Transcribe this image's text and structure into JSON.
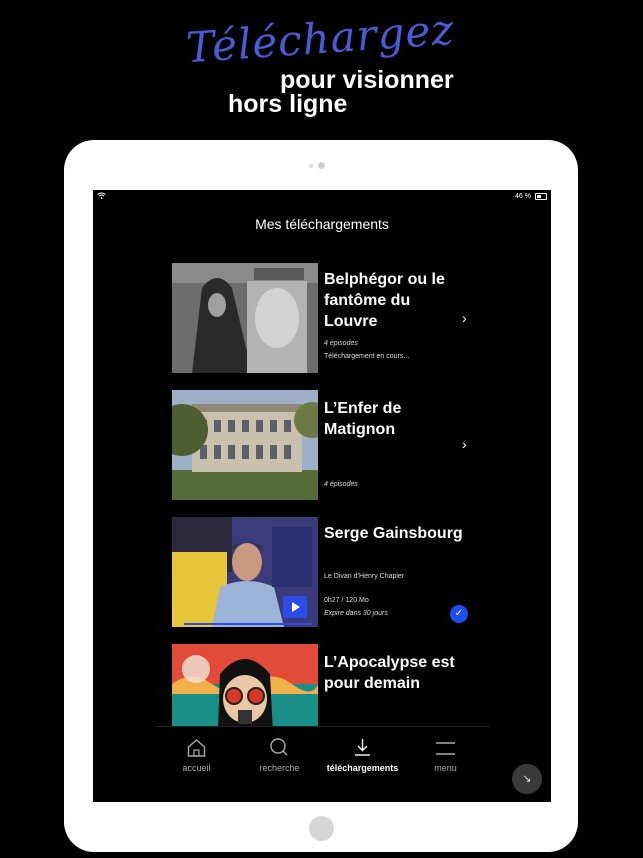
{
  "promo": {
    "script_word": "Téléchargez",
    "line1": "pour visionner",
    "line2": "hors ligne"
  },
  "status_bar": {
    "battery": "46 %"
  },
  "screen": {
    "title": "Mes téléchargements",
    "items": [
      {
        "title": "Belphégor ou le fantôme du Louvre",
        "episodes": "4 épisodes",
        "status": "Téléchargement en cours..."
      },
      {
        "title": "L’Enfer de Matignon",
        "episodes": "4 épisodes"
      },
      {
        "title": "Serge Gainsbourg",
        "subtitle": "Le Divan d’Henry Chapier",
        "duration_size": "0h27 / 120 Mo",
        "expiry": "Expire dans 30 jours"
      },
      {
        "title": "L’Apocalypse est pour demain"
      }
    ]
  },
  "nav": {
    "tabs": [
      {
        "label": "accueil",
        "icon": "home-icon"
      },
      {
        "label": "recherche",
        "icon": "search-icon"
      },
      {
        "label": "téléchargements",
        "icon": "download-icon",
        "active": true
      },
      {
        "label": "menu",
        "icon": "menu-icon"
      }
    ]
  },
  "colors": {
    "accent": "#2d4be8",
    "script": "#4b5bd6",
    "background": "#000000"
  }
}
